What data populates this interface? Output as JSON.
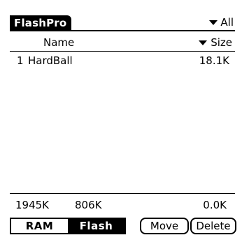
{
  "app": {
    "title": "FlashPro",
    "category": "All"
  },
  "columns": {
    "name": "Name",
    "size": "Size"
  },
  "items": [
    {
      "index": "1",
      "name": "HardBall",
      "size": "18.1K"
    }
  ],
  "footer": {
    "free_total": "1945K",
    "free_flash": "806K",
    "selected_total": "0.0K",
    "segments": [
      "RAM",
      "Flash"
    ],
    "selected_segment": "Flash",
    "move_label": "Move",
    "delete_label": "Delete"
  }
}
